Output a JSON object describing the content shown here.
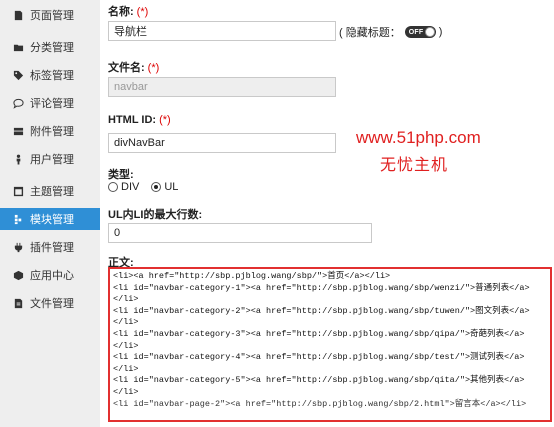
{
  "sidebar": {
    "items": [
      {
        "label": "页面管理",
        "icon": "page-icon",
        "active": false
      },
      {
        "label": "分类管理",
        "icon": "folder-icon",
        "active": false
      },
      {
        "label": "标签管理",
        "icon": "tag-icon",
        "active": false
      },
      {
        "label": "评论管理",
        "icon": "comment-icon",
        "active": false
      },
      {
        "label": "附件管理",
        "icon": "attachment-icon",
        "active": false
      },
      {
        "label": "用户管理",
        "icon": "user-icon",
        "active": false
      },
      {
        "label": "主题管理",
        "icon": "theme-icon",
        "active": false
      },
      {
        "label": "模块管理",
        "icon": "module-icon",
        "active": true
      },
      {
        "label": "插件管理",
        "icon": "plugin-icon",
        "active": false
      },
      {
        "label": "应用中心",
        "icon": "app-center-icon",
        "active": false
      },
      {
        "label": "文件管理",
        "icon": "file-icon",
        "active": false
      }
    ]
  },
  "form": {
    "name_label": "名称:",
    "name_required": "(*)",
    "name_value": "导航栏",
    "hide_title_label": "( 隐藏标题：",
    "hide_title_toggle": "OFF",
    "hide_title_close": ")",
    "filename_label": "文件名:",
    "filename_required": "(*)",
    "filename_value": "navbar",
    "htmlid_label": "HTML ID:",
    "htmlid_required": "(*)",
    "htmlid_value": "divNavBar",
    "type_label": "类型:",
    "type_options": [
      {
        "label": "DIV",
        "selected": false
      },
      {
        "label": "UL",
        "selected": true
      }
    ],
    "max_rows_label": "UL内LI的最大行数:",
    "max_rows_value": "0",
    "content_label": "正文:",
    "content_lines": [
      "<li><a href=\"http://sbp.pjblog.wang/sbp/\">首页</a></li>",
      "<li id=\"navbar-category-1\"><a href=\"http://sbp.pjblog.wang/sbp/wenzi/\">普通列表</a>",
      "</li>",
      "<li id=\"navbar-category-2\"><a href=\"http://sbp.pjblog.wang/sbp/tuwen/\">图文列表</a>",
      "</li>",
      "<li id=\"navbar-category-3\"><a href=\"http://sbp.pjblog.wang/sbp/qipa/\">奇葩列表</a>",
      "</li>",
      "<li id=\"navbar-category-4\"><a href=\"http://sbp.pjblog.wang/sbp/test/\">测试列表</a>",
      "</li>",
      "<li id=\"navbar-category-5\"><a href=\"http://sbp.pjblog.wang/sbp/qita/\">其他列表</a>",
      "</li>",
      "<li id=\"navbar-page-2\"><a href=\"http://sbp.pjblog.wang/sbp/2.html\">留言本</a></li>"
    ]
  },
  "watermark": {
    "url": "www.51php.com",
    "name": "无忧主机",
    "color": "#e02020"
  },
  "colors": {
    "sidebar_bg": "#eeeeee",
    "active_bg": "#2f8fd6",
    "required": "#dd0000",
    "highlight_border": "#e23030"
  }
}
